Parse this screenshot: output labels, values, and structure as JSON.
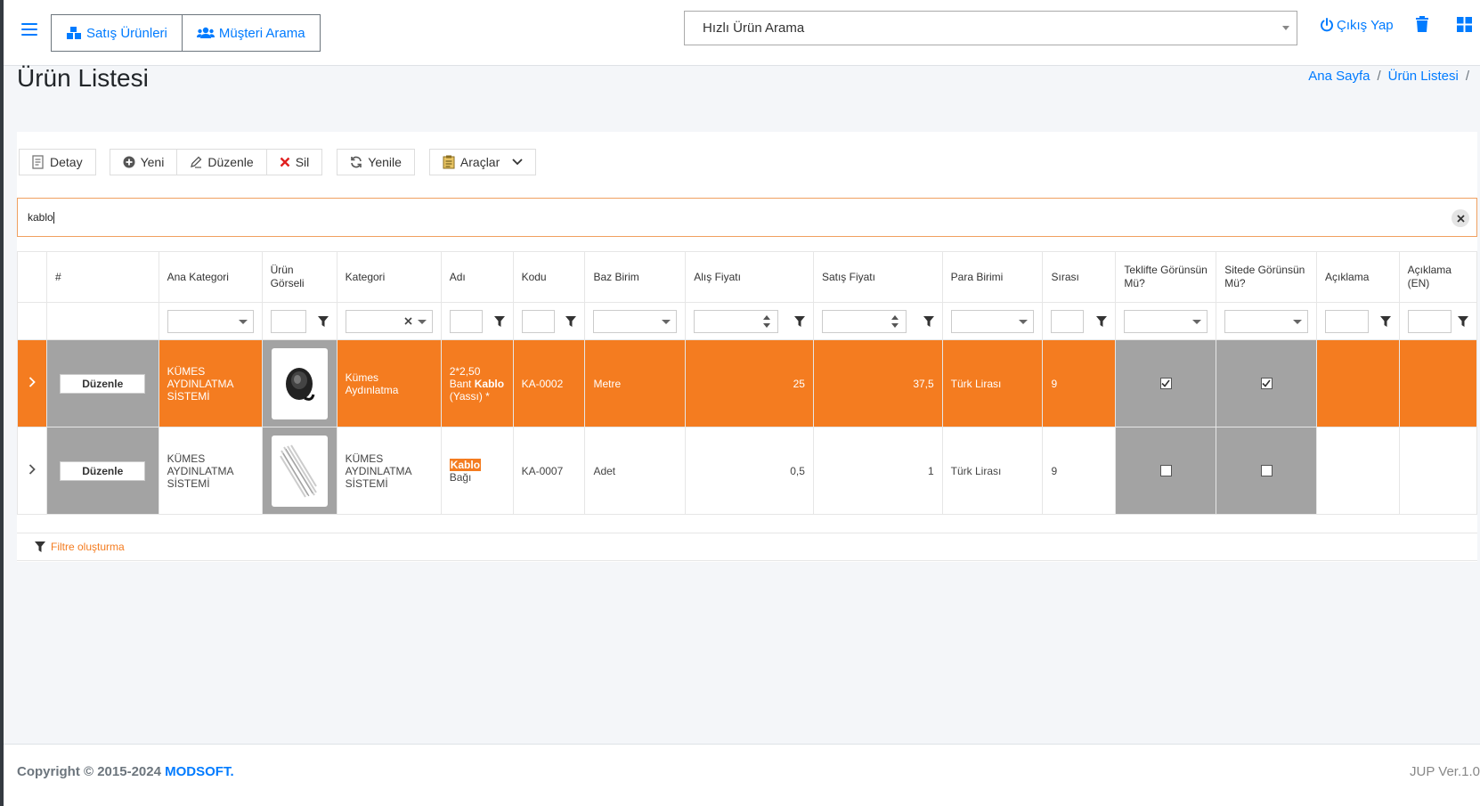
{
  "navbar": {
    "nav_buttons": [
      "Satış Ürünleri",
      "Müşteri Arama"
    ],
    "quick_search": "Hızlı Ürün Arama",
    "logout": "Çıkış Yap"
  },
  "page": {
    "title": "Ürün Listesi",
    "breadcrumb": [
      "Ana Sayfa",
      "/",
      "Ürün Listesi",
      "/"
    ]
  },
  "toolbar": {
    "detay": "Detay",
    "yeni": "Yeni",
    "duzenle": "Düzenle",
    "sil": "Sil",
    "yenile": "Yenile",
    "araclar": "Araçlar"
  },
  "search": {
    "value": "kablo"
  },
  "grid": {
    "columns": [
      "#",
      "Ana Kategori",
      "Ürün Görseli",
      "Kategori",
      "Adı",
      "Kodu",
      "Baz Birim",
      "Alış Fiyatı",
      "Satış Fiyatı",
      "Para Birimi",
      "Sırası",
      "Teklifte Görünsün Mü?",
      "Sitede Görünsün Mü?",
      "Açıklama",
      "Açıklama (EN)"
    ],
    "edit_label": "Düzenle",
    "rows": [
      {
        "ana_kategori": "KÜMES AYDINLATMA SİSTEMİ",
        "kategori": "Kümes Aydınlatma",
        "adi_pre": "2*2,50 Bant ",
        "adi_hl": "Kablo",
        "adi_post": " (Yassı) *",
        "kodu": "KA-0002",
        "baz_birim": "Metre",
        "alis": "25",
        "satis": "37,5",
        "para": "Türk Lirası",
        "sira": "9",
        "teklif": true,
        "site": true
      },
      {
        "ana_kategori": "KÜMES AYDINLATMA SİSTEMİ",
        "kategori": "KÜMES AYDINLATMA SİSTEMİ",
        "adi_pre": "",
        "adi_hl": "Kablo",
        "adi_post": " Bağı",
        "kodu": "KA-0007",
        "baz_birim": "Adet",
        "alis": "0,5",
        "satis": "1",
        "para": "Türk Lirası",
        "sira": "9",
        "teklif": false,
        "site": false
      }
    ]
  },
  "filter_builder": "Filtre oluşturma",
  "footer": {
    "copyright": "Copyright © 2015-2024 ",
    "brand": "MODSOFT.",
    "version": "JUP Ver.1.0"
  },
  "colors": {
    "accent": "#007bff",
    "selected_row": "#f47c20"
  }
}
